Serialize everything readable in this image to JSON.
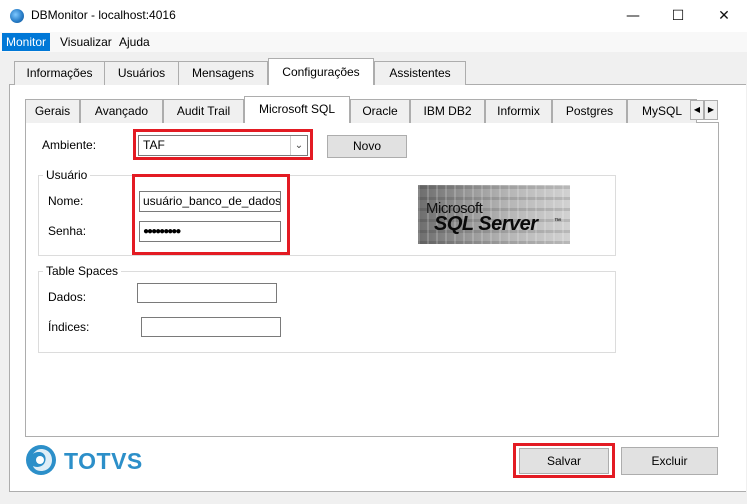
{
  "window": {
    "title": "DBMonitor - localhost:4016",
    "minimize_label": "—",
    "maximize_label": "☐",
    "close_label": "✕"
  },
  "menu": [
    "Monitor",
    "Visualizar",
    "Ajuda"
  ],
  "main_tabs": [
    "Informações",
    "Usuários",
    "Mensagens",
    "Configurações",
    "Assistentes"
  ],
  "main_tab_selected": "Configurações",
  "db_tabs": [
    "Gerais",
    "Avançado",
    "Audit Trail",
    "Microsoft SQL",
    "Oracle",
    "IBM DB2",
    "Informix",
    "Postgres",
    "MySQL"
  ],
  "db_tab_selected": "Microsoft SQL",
  "tab_scroll": {
    "left": "◀",
    "right": "▶"
  },
  "ambiente": {
    "label": "Ambiente:",
    "value": "TAF",
    "arrow": "⌄",
    "novo_button": "Novo"
  },
  "usuario": {
    "group_title": "Usuário",
    "nome_label": "Nome:",
    "nome_value": "usuário_banco_de_dados",
    "senha_label": "Senha:",
    "senha_value": "●●●●●●●●●"
  },
  "logo": {
    "line1": "Microsoft",
    "line2": "SQL Server",
    "tm": "™"
  },
  "table_spaces": {
    "group_title": "Table Spaces",
    "dados_label": "Dados:",
    "dados_value": "",
    "indices_label": "Índices:",
    "indices_value": ""
  },
  "brand": "TOTVS",
  "footer": {
    "salvar_button": "Salvar",
    "excluir_button": "Excluir"
  },
  "colors": {
    "highlight_red": "#e31b23",
    "menu_active": "#0078d7",
    "brand_blue": "#2c8fc9"
  }
}
